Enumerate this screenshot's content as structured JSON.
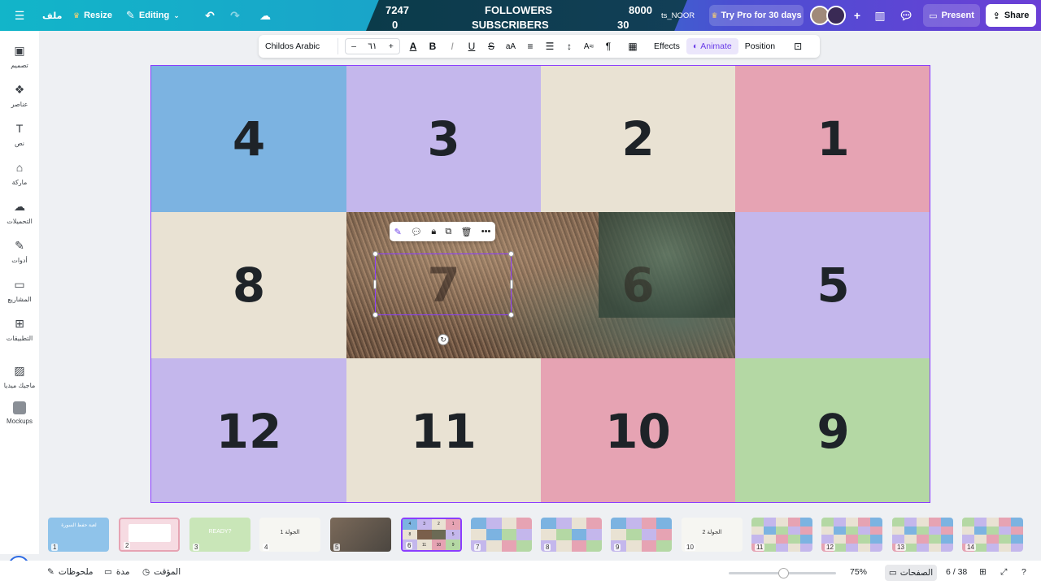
{
  "topbar": {
    "menu_icon": "menu-icon",
    "file_label": "ملف",
    "resize_label": "Resize",
    "editing_label": "Editing",
    "followers_label": "FOLLOWERS",
    "followers_value": "7247",
    "followers_goal": "8000",
    "subscribers_label": "SUBSCRIBERS",
    "subscribers_value": "0",
    "subscribers_goal": "30",
    "channel_name": "ts_NOOR",
    "pro_label": "Try Pro for 30 days",
    "present_label": "Present",
    "share_label": "Share"
  },
  "sidebar": {
    "items": [
      {
        "label": "تصميم",
        "icon": "layout-icon"
      },
      {
        "label": "عناصر",
        "icon": "elements-icon"
      },
      {
        "label": "نص",
        "icon": "text-icon"
      },
      {
        "label": "ماركة",
        "icon": "brand-icon"
      },
      {
        "label": "التحميلات",
        "icon": "upload-icon"
      },
      {
        "label": "أدوات",
        "icon": "draw-icon"
      },
      {
        "label": "المشاريع",
        "icon": "folder-icon"
      },
      {
        "label": "التطبيقات",
        "icon": "apps-icon"
      },
      {
        "label": "ماجيك ميديا",
        "icon": "magic-media-icon"
      },
      {
        "label": "Mockups",
        "icon": "mockups-icon"
      }
    ]
  },
  "format_toolbar": {
    "font_name": "Childos Arabic",
    "font_size": "٦١",
    "minus": "–",
    "plus": "+",
    "effects_label": "Effects",
    "animate_label": "Animate",
    "position_label": "Position"
  },
  "canvas": {
    "cells": [
      "4",
      "3",
      "2",
      "1",
      "8",
      "7",
      "6",
      "5",
      "12",
      "11",
      "10",
      "9"
    ],
    "colors": {
      "blue": "#7cb3e1",
      "lavender": "#c4b7ec",
      "cream": "#e9e2d3",
      "pink": "#e6a3b3",
      "green": "#b4d8a4"
    }
  },
  "thumbnails": [
    {
      "num": "1",
      "title": "لعبة حفظ السورة"
    },
    {
      "num": "2"
    },
    {
      "num": "3",
      "title": "READY?"
    },
    {
      "num": "4",
      "title": "الجولة 1"
    },
    {
      "num": "5"
    },
    {
      "num": "6"
    },
    {
      "num": "7"
    },
    {
      "num": "8"
    },
    {
      "num": "9"
    },
    {
      "num": "10",
      "title": "الجولة 2"
    },
    {
      "num": "11"
    },
    {
      "num": "12"
    },
    {
      "num": "13"
    },
    {
      "num": "14"
    }
  ],
  "bottombar": {
    "notes_label": "ملحوظات",
    "duration_label": "مدة",
    "timer_label": "المؤقت",
    "zoom": "75%",
    "pages_label": "الصفحات",
    "page_count": "6 / 38"
  }
}
